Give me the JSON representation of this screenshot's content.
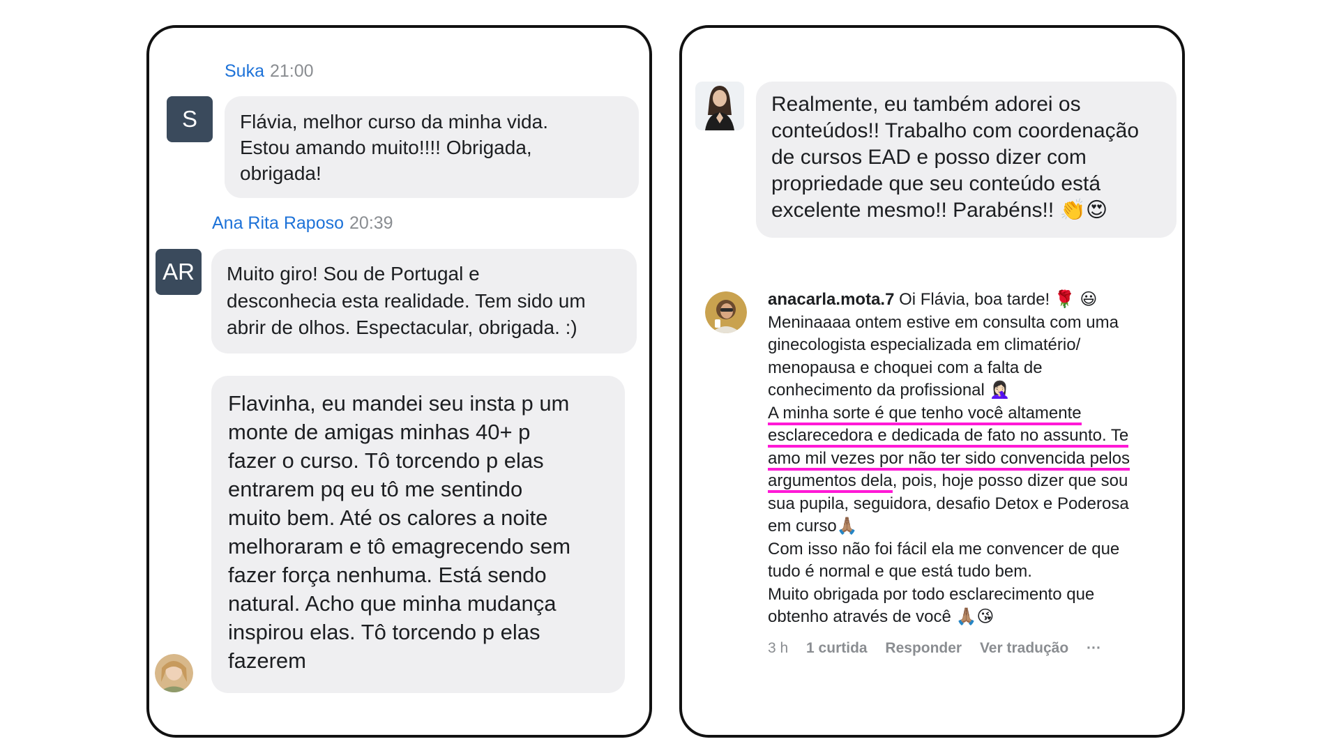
{
  "left_card": {
    "messages": [
      {
        "author": "Suka",
        "time": "21:00",
        "avatar_initials": "S",
        "text": "Flávia,  melhor curso da minha vida.\nEstou amando muito!!!! Obrigada,\nobrigada!"
      },
      {
        "author": "Ana Rita Raposo",
        "time": "20:39",
        "avatar_initials": "AR",
        "text": "Muito giro! Sou de Portugal e\ndesconhecia esta realidade. Tem sido um\nabrir de olhos. Espectacular, obrigada. :)"
      },
      {
        "text": "Flavinha, eu mandei seu insta p um\nmonte de amigas minhas 40+ p\nfazer o curso. Tô torcendo p elas\nentrarem pq eu tô me sentindo\nmuito bem. Até os calores a noite\nmelhoraram e tô emagrecendo sem\nfazer força nenhuma. Está sendo\nnatural. Acho que minha mudança\ninspirou elas. Tô torcendo p elas\nfazerem"
      }
    ]
  },
  "right_card": {
    "top_message": {
      "text": "Realmente, eu também adorei os\nconteúdos!! Trabalho com coordenação\nde cursos EAD e posso dizer com\npropriedade que seu conteúdo está\nexcelente mesmo!! Parabéns!! 👏😍"
    },
    "comment": {
      "username": "anacarla.mota.7",
      "line1_rest": " Oi Flávia, boa tarde! 🌹 😃",
      "line2": "Meninaaaa ontem estive em consulta com uma",
      "line3": "ginecologista especializada em climatério/",
      "line4": "menopausa e choquei com a falta de",
      "line5": "conhecimento da profissional 🤦🏻‍♀️",
      "line6": "A minha sorte é que tenho você altamente",
      "line7": "esclarecedora e dedicada de fato no assunto. Te",
      "line8": "amo mil vezes por não ter sido convencida pelos",
      "line9_hl": "argumentos dela",
      "line9_rest": ", pois, hoje posso dizer que sou",
      "line10": "sua pupila, seguidora, desafio Detox e Poderosa",
      "line11": "em curso🙏🏽",
      "line12": "Com isso não foi fácil ela me convencer de que",
      "line13": "tudo é normal e que está tudo bem.",
      "line14": "Muito obrigada por todo esclarecimento que",
      "line15": "obtenho através de você 🙏🏽😘"
    },
    "meta": {
      "age": "3 h",
      "likes": "1 curtida",
      "reply": "Responder",
      "translate": "Ver tradução",
      "more": "···"
    }
  },
  "colors": {
    "author_blue": "#1d72d8",
    "bubble_gray": "#efeff1",
    "avatar_slate": "#3a4a5c",
    "highlight_magenta": "#ff19d6"
  }
}
